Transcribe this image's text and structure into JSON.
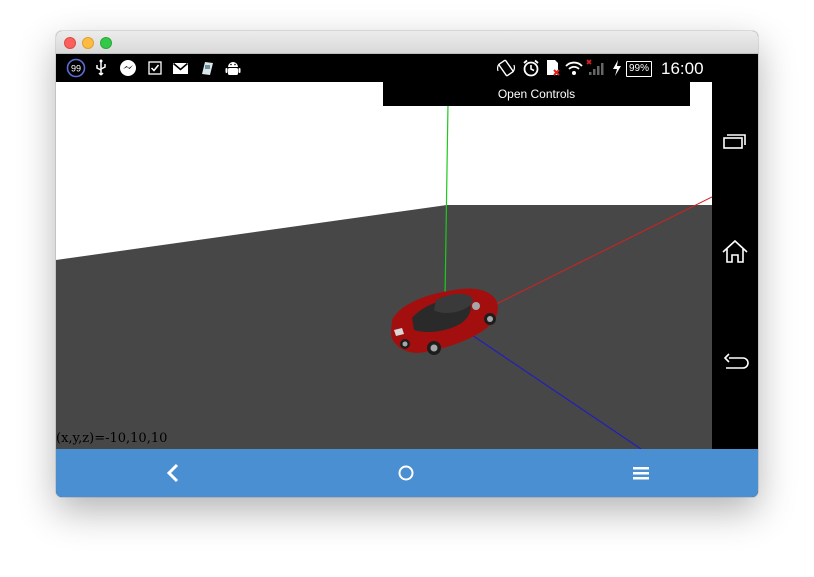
{
  "status_bar": {
    "notification_badge": "99",
    "battery_label": "99%",
    "time": "16:00",
    "icons": [
      "notification-count-icon",
      "usb-icon",
      "messenger-icon",
      "checkbox-icon",
      "gmail-icon",
      "tag-icon",
      "android-icon",
      "rotate-icon",
      "alarm-icon",
      "sim-icon",
      "wifi-icon",
      "signal-icon",
      "charging-icon",
      "battery-icon"
    ]
  },
  "scene": {
    "controls_button": "Open Controls",
    "coordinates": "(x,y,z)=-10,10,10",
    "floor_color": "#474747",
    "sky_color": "#ffffff",
    "car_color": "#a30f0f",
    "axis_colors": {
      "x": "#d42020",
      "y": "#1ec81e",
      "z": "#2020b8"
    }
  },
  "side_nav": {
    "buttons": [
      "recent-apps",
      "home",
      "back"
    ]
  },
  "bottom_bar": {
    "color": "#4a8fd1",
    "buttons": [
      "back",
      "home",
      "menu"
    ]
  }
}
